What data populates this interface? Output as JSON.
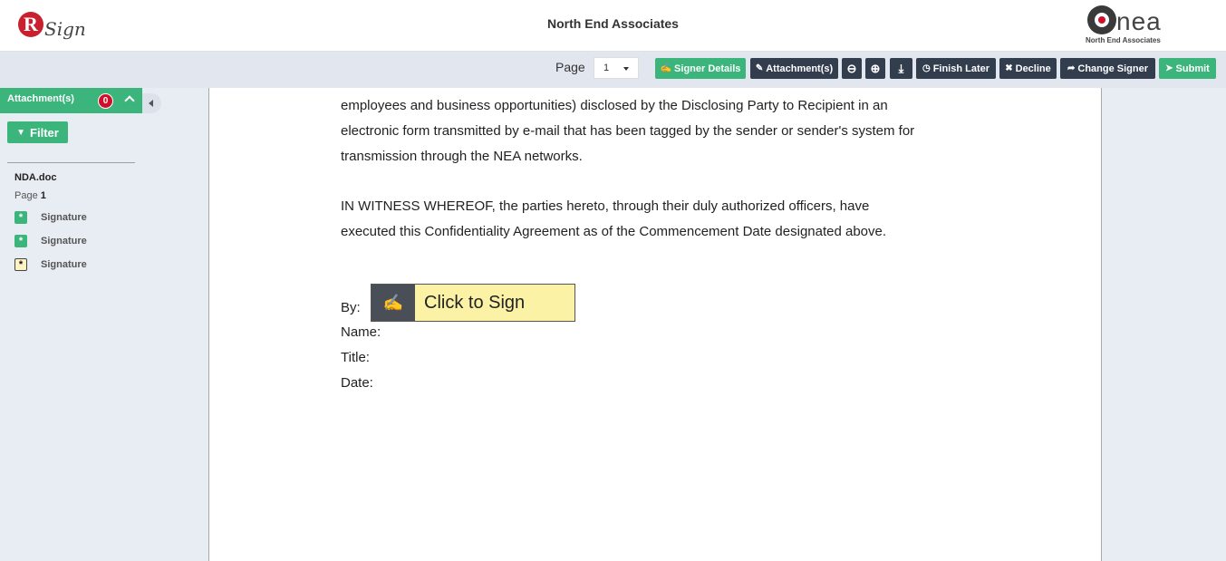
{
  "header": {
    "rsign_logo_letter": "R",
    "rsign_logo_word": "Sign",
    "title": "North End Associates",
    "nea_logo_word": "nea",
    "nea_logo_sub": "North End Associates"
  },
  "toolbar": {
    "page_label": "Page",
    "page_value": "1",
    "buttons": [
      {
        "label": "Signer Details",
        "icon": "pen-icon"
      },
      {
        "label": "Attachment(s)",
        "icon": "paperclip-icon"
      },
      {
        "label": "",
        "icon": "zoom-out-icon"
      },
      {
        "label": "",
        "icon": "zoom-in-icon"
      },
      {
        "label": "",
        "icon": "download-icon"
      },
      {
        "label": "Finish Later",
        "icon": "clock-icon"
      },
      {
        "label": "Decline",
        "icon": "x-icon"
      },
      {
        "label": "Change Signer",
        "icon": "share-icon"
      },
      {
        "label": "Submit",
        "icon": "send-icon"
      }
    ],
    "icon_glyphs": {
      "pen": "✍",
      "paperclip": "✎",
      "zoom_out": "⊖",
      "zoom_in": "⊕",
      "download": "⤓",
      "clock": "◷",
      "x": "✖",
      "share": "➦",
      "send": "➤"
    }
  },
  "sidebar": {
    "attachments_label": "Attachment(s)",
    "attachments_count": "0",
    "filter_label": "Filter",
    "doc_name": "NDA.doc",
    "page_prefix": "Page",
    "page_number": "1",
    "signatures": [
      {
        "label": "Signature",
        "status": "done"
      },
      {
        "label": "Signature",
        "status": "done"
      },
      {
        "label": "Signature",
        "status": "pending"
      }
    ]
  },
  "document": {
    "para1": [
      "employees and business opportunities) disclosed by the Disclosing Party to Recipient in an",
      "electronic form transmitted by e-mail that has been tagged by the sender or sender's system for",
      "transmission through the NEA networks."
    ],
    "para2": [
      "IN WITNESS WHEREOF, the parties hereto, through their duly authorized officers, have",
      "executed this Confidentiality Agreement as of the Commencement Date designated above."
    ],
    "by_label": "By:",
    "sign_button": "Click to Sign",
    "name_label": "Name:",
    "title_label": "Title:",
    "date_label": "Date:"
  },
  "colors": {
    "green": "#3bb57c",
    "dark": "#323d4e",
    "red": "#d0102a",
    "sign_yellow": "#fbf2a6"
  }
}
